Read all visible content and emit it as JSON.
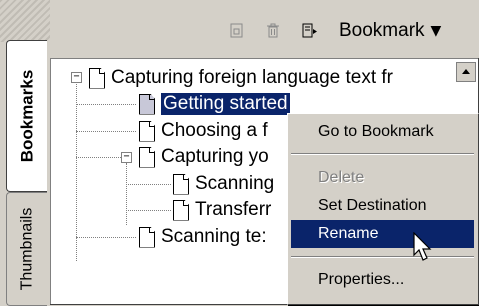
{
  "tabs": [
    {
      "label": "Bookmarks",
      "active": true
    },
    {
      "label": "Thumbnails",
      "active": false
    }
  ],
  "toolbar": {
    "new_bookmark_icon": "new-bookmark-icon",
    "delete_icon": "trash-icon",
    "options_icon": "options-icon",
    "bookmark_menu_label": "Bookmark",
    "caret": "▼"
  },
  "tree": {
    "expander_open": "−",
    "nodes": [
      {
        "label": "Capturing foreign language text  fr"
      },
      {
        "label": "Getting started",
        "selected": true
      },
      {
        "label": "Choosing a f"
      },
      {
        "label": "Capturing yo"
      },
      {
        "label": "Scanning"
      },
      {
        "label": "Transferr"
      },
      {
        "label": "Scanning te:"
      }
    ]
  },
  "context_menu": {
    "items": [
      {
        "label": "Go to Bookmark",
        "enabled": true
      },
      {
        "label": "Delete",
        "enabled": false
      },
      {
        "label": "Set Destination",
        "enabled": true
      },
      {
        "label": "Rename",
        "enabled": true,
        "highlighted": true
      },
      {
        "label": "Properties...",
        "enabled": true
      }
    ]
  },
  "colors": {
    "selection": "#0a246a",
    "panel_bg": "#ffffff",
    "chrome": "#d4d0c8"
  }
}
